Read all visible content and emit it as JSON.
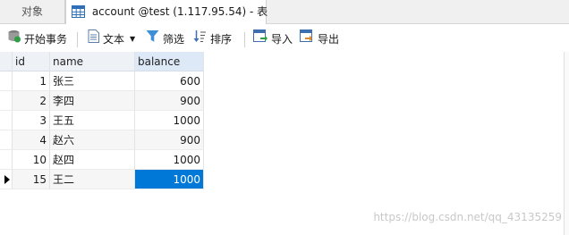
{
  "tabs": {
    "objects_label": "对象",
    "active_label": "account @test (1.117.95.54) - 表"
  },
  "toolbar": {
    "begin_transaction": "开始事务",
    "text": "文本",
    "filter": "筛选",
    "sort": "排序",
    "import": "导入",
    "export": "导出"
  },
  "grid": {
    "columns": [
      "id",
      "name",
      "balance"
    ],
    "rows": [
      {
        "id": "1",
        "name": "张三",
        "balance": "600"
      },
      {
        "id": "2",
        "name": "李四",
        "balance": "900"
      },
      {
        "id": "3",
        "name": "王五",
        "balance": "1000"
      },
      {
        "id": "4",
        "name": "赵六",
        "balance": "900"
      },
      {
        "id": "10",
        "name": "赵四",
        "balance": "1000"
      },
      {
        "id": "15",
        "name": "王二",
        "balance": "1000"
      }
    ]
  },
  "watermark": "https://blog.csdn.net/qq_43135259",
  "colors": {
    "selection": "#0078d7",
    "header_bg": "#eef2f7"
  }
}
